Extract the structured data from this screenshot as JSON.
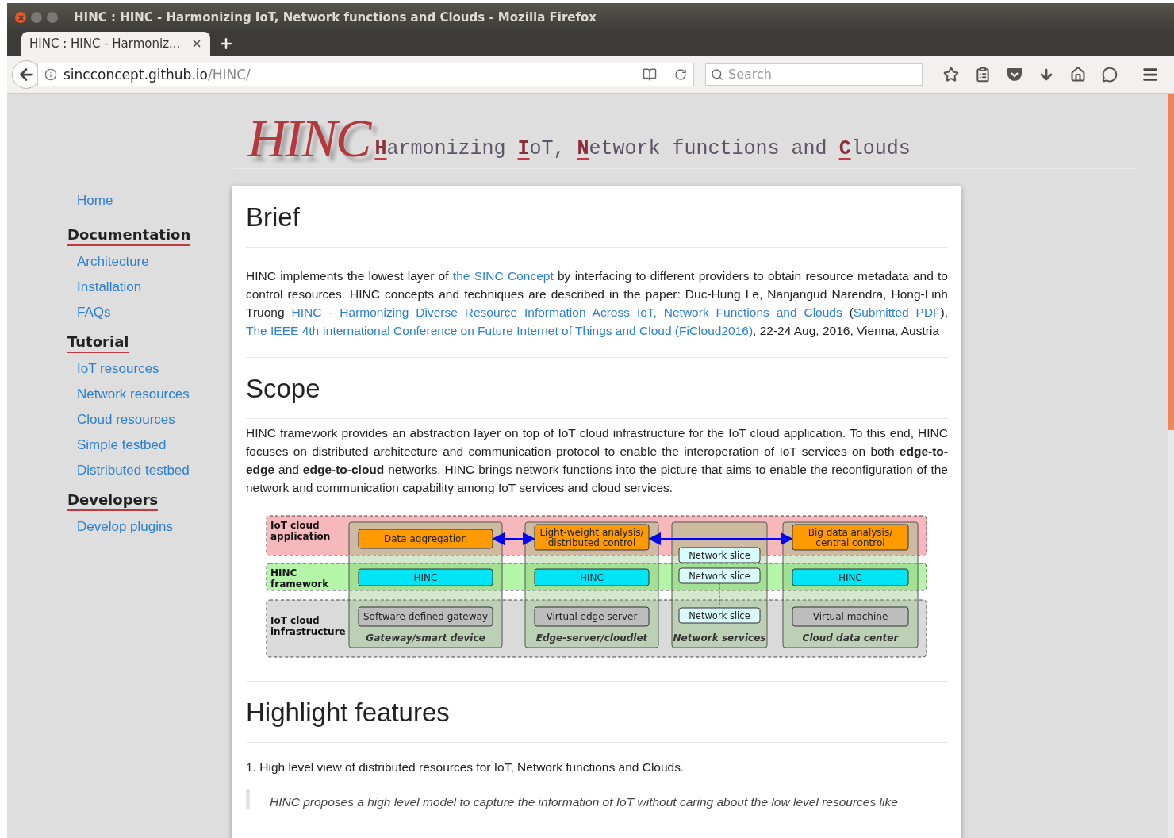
{
  "window": {
    "title": "HINC : HINC - Harmonizing IoT, Network functions and Clouds - Mozilla Firefox"
  },
  "tabs": [
    {
      "label": "HINC : HINC - Harmoniz...",
      "selected": true
    }
  ],
  "address_bar": {
    "host": "sincconcept.github.io",
    "path": "/HINC/"
  },
  "search": {
    "placeholder": "Search"
  },
  "header": {
    "logo": "HINC",
    "tagline": [
      {
        "text": "H",
        "accent": true
      },
      {
        "text": "armonizing ",
        "accent": false
      },
      {
        "text": "I",
        "accent": true
      },
      {
        "text": "oT, ",
        "accent": false
      },
      {
        "text": "N",
        "accent": true
      },
      {
        "text": "etwork functions and ",
        "accent": false
      },
      {
        "text": "C",
        "accent": true
      },
      {
        "text": "louds",
        "accent": false
      }
    ]
  },
  "sidebar": {
    "items": [
      {
        "kind": "link",
        "label": "Home"
      },
      {
        "kind": "section",
        "label": "Documentation",
        "children": [
          {
            "label": "Architecture"
          },
          {
            "label": "Installation"
          },
          {
            "label": "FAQs"
          }
        ]
      },
      {
        "kind": "section",
        "label": "Tutorial",
        "children": [
          {
            "label": "IoT resources"
          },
          {
            "label": "Network resources"
          },
          {
            "label": "Cloud resources"
          },
          {
            "label": "Simple testbed"
          },
          {
            "label": "Distributed testbed"
          }
        ]
      },
      {
        "kind": "section",
        "label": "Developers",
        "children": [
          {
            "label": "Develop plugins"
          }
        ]
      }
    ]
  },
  "sections": [
    {
      "heading": "Brief",
      "paragraphs": [
        [
          {
            "kind": "text",
            "text": "HINC implements the lowest layer of "
          },
          {
            "kind": "link",
            "text": "the SINC Concept"
          },
          {
            "kind": "text",
            "text": " by interfacing to different providers to obtain resource metadata and to control resources. HINC concepts and techniques are described in the paper: Duc-Hung Le, Nanjangud Narendra, Hong-Linh Truong "
          },
          {
            "kind": "link",
            "text": "HINC - Harmonizing Diverse Resource Information Across IoT, Network Functions and Clouds"
          },
          {
            "kind": "text",
            "text": " ("
          },
          {
            "kind": "link",
            "text": "Submitted PDF"
          },
          {
            "kind": "text",
            "text": "), "
          },
          {
            "kind": "link",
            "text": "The IEEE 4th International Conference on Future Internet of Things and Cloud (FiCloud2016)"
          },
          {
            "kind": "text",
            "text": ", 22-24 Aug, 2016, Vienna, Austria"
          }
        ]
      ]
    },
    {
      "heading": "Scope",
      "paragraphs": [
        [
          {
            "kind": "text",
            "text": "HINC framework provides an abstraction layer on top of IoT cloud infrastructure for the IoT cloud application. To this end, HINC focuses on distributed architecture and communication protocol to enable the interoperation of IoT services on both **edge-to-edge** and **edge-to-cloud** networks. HINC brings network functions into the picture that aims to enable the reconfiguration of the network and communication capability among IoT services and cloud services."
          }
        ]
      ],
      "diagram": {
        "layers": [
          {
            "lines": [
              "IoT cloud",
              "application"
            ],
            "color": "#f7b8bc"
          },
          {
            "lines": [
              "HINC",
              "framework"
            ],
            "color": "#b4f5a8"
          },
          {
            "lines": [
              "IoT cloud",
              "infrastructure"
            ],
            "color": "#dadada"
          }
        ],
        "columns": [
          {
            "title": "Gateway/smart device",
            "arrow_to_next": true,
            "boxes": [
              {
                "kind": "app",
                "lines": [
                  "Data aggregation"
                ]
              },
              {
                "kind": "hinc",
                "lines": [
                  "HINC"
                ]
              },
              {
                "kind": "resource",
                "lines": [
                  "Software defined gateway"
                ]
              }
            ]
          },
          {
            "title": "Edge-server/cloudlet",
            "arrow_to_next": true,
            "boxes": [
              {
                "kind": "app",
                "lines": [
                  "Light-weight analysis/",
                  "distributed control"
                ]
              },
              {
                "kind": "hinc",
                "lines": [
                  "HINC"
                ]
              },
              {
                "kind": "resource",
                "lines": [
                  "Virtual edge server"
                ]
              }
            ]
          },
          {
            "title": "Network services",
            "arrow_to_next": false,
            "boxes": [
              {
                "kind": "slice",
                "lines": [
                  "Network slice"
                ]
              },
              {
                "kind": "slice",
                "lines": [
                  "Network slice"
                ]
              },
              {
                "kind": "slice",
                "lines": [
                  "Network slice"
                ]
              }
            ]
          },
          {
            "title": "Cloud data center",
            "boxes": [
              {
                "kind": "app",
                "lines": [
                  "Big data analysis/",
                  "central control"
                ]
              },
              {
                "kind": "hinc",
                "lines": [
                  "HINC"
                ]
              },
              {
                "kind": "resource",
                "lines": [
                  "Virtual machine"
                ]
              }
            ]
          }
        ]
      }
    },
    {
      "heading": "Highlight features",
      "list": [
        {
          "number": "1.",
          "text": "High level view of distributed resources for IoT, Network functions and Clouds."
        }
      ],
      "quote": "HINC proposes a high level model to capture the information of IoT without caring about the low level resources like"
    }
  ]
}
